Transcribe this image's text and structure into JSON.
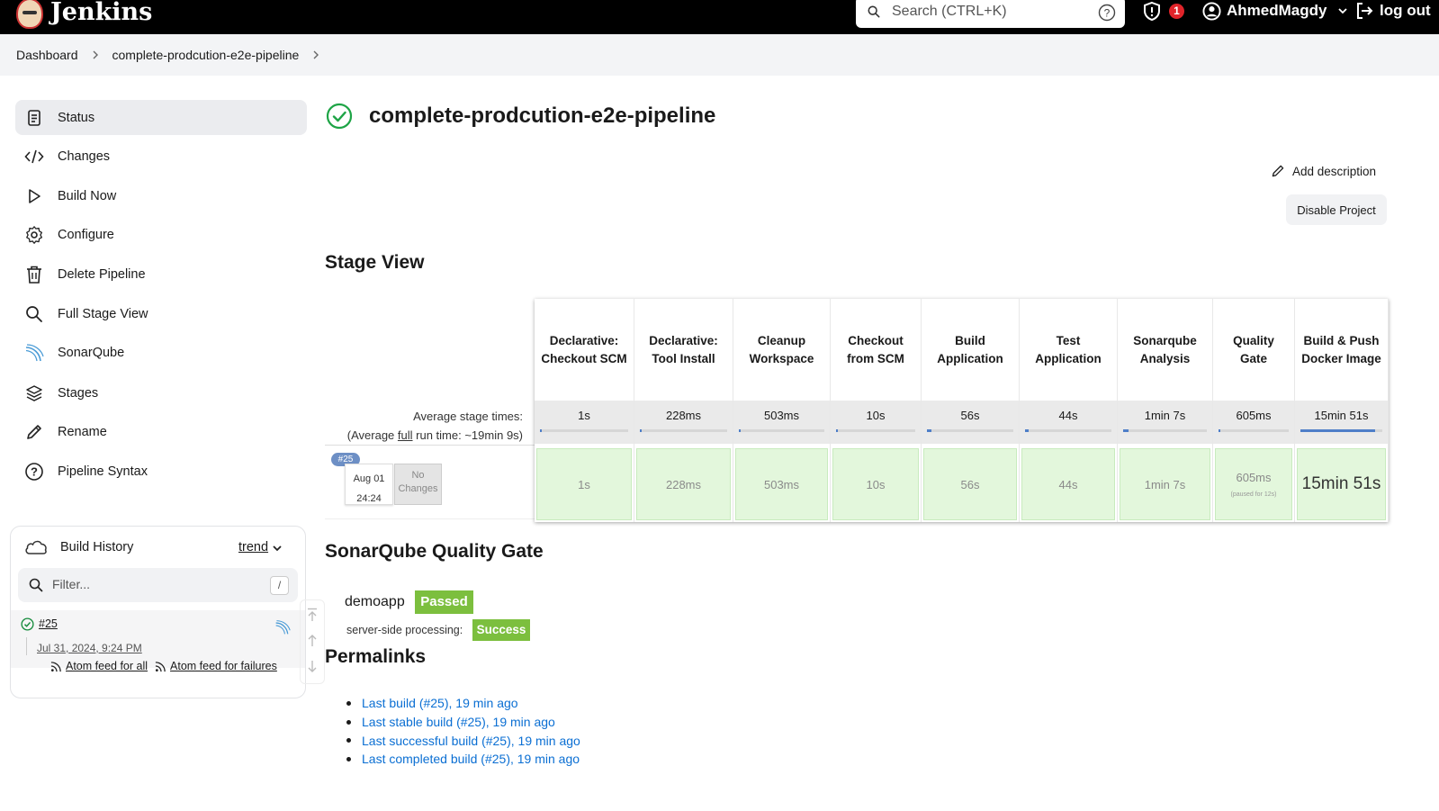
{
  "header": {
    "app_name": "Jenkins",
    "search_placeholder": "Search (CTRL+K)",
    "security_count": "1",
    "user_name": "AhmedMagdy",
    "logout_label": "log out"
  },
  "breadcrumb": {
    "items": [
      "Dashboard",
      "complete-prodcution-e2e-pipeline"
    ]
  },
  "sidebar": {
    "items": [
      {
        "label": "Status",
        "icon": "document-icon",
        "active": true
      },
      {
        "label": "Changes",
        "icon": "code-icon"
      },
      {
        "label": "Build Now",
        "icon": "play-icon"
      },
      {
        "label": "Configure",
        "icon": "gear-icon"
      },
      {
        "label": "Delete Pipeline",
        "icon": "trash-icon"
      },
      {
        "label": "Full Stage View",
        "icon": "magnifier-icon"
      },
      {
        "label": "SonarQube",
        "icon": "sonarqube-icon"
      },
      {
        "label": "Stages",
        "icon": "layers-icon"
      },
      {
        "label": "Rename",
        "icon": "pencil-icon"
      },
      {
        "label": "Pipeline Syntax",
        "icon": "question-circle-icon"
      }
    ]
  },
  "build_history": {
    "title": "Build History",
    "trend_label": "trend",
    "filter_placeholder": "Filter...",
    "filter_shortcut": "/",
    "builds": [
      {
        "number": "#25",
        "date": "Jul 31, 2024, 9:24 PM",
        "status": "success"
      }
    ],
    "feed_all": "Atom feed for all",
    "feed_failures": "Atom feed for failures"
  },
  "project": {
    "title": "complete-prodcution-e2e-pipeline",
    "add_description": "Add description",
    "disable_button": "Disable Project"
  },
  "stage_view": {
    "title": "Stage View",
    "avg_label_1": "Average stage times:",
    "avg_label_2_prefix": "(Average ",
    "avg_label_2_link": "full",
    "avg_label_2_suffix": " run time: ~19min 9s)",
    "build": {
      "badge": "#25",
      "date": "Aug 01",
      "time": "24:24",
      "changes": "No Changes"
    },
    "stages": [
      {
        "name": "Declarative: Checkout SCM",
        "avg": "1s",
        "run": "1s",
        "share": 0.001
      },
      {
        "name": "Declarative: Tool Install",
        "avg": "228ms",
        "run": "228ms",
        "share": 0.0002
      },
      {
        "name": "Cleanup Workspace",
        "avg": "503ms",
        "run": "503ms",
        "share": 0.0004
      },
      {
        "name": "Checkout from SCM",
        "avg": "10s",
        "run": "10s",
        "share": 0.009
      },
      {
        "name": "Build Application",
        "avg": "56s",
        "run": "56s",
        "share": 0.05
      },
      {
        "name": "Test Application",
        "avg": "44s",
        "run": "44s",
        "share": 0.04
      },
      {
        "name": "Sonarqube Analysis",
        "avg": "1min 7s",
        "run": "1min 7s",
        "share": 0.06
      },
      {
        "name": "Quality Gate",
        "avg": "605ms",
        "run": "605ms",
        "share": 0.0005,
        "note": "(paused for 12s)"
      },
      {
        "name": "Build & Push Docker Image",
        "avg": "15min 51s",
        "run": "15min 51s",
        "share": 0.83
      }
    ]
  },
  "sonarqube": {
    "title": "SonarQube Quality Gate",
    "project": "demoapp",
    "status": "Passed",
    "processing_label": "server-side processing:",
    "processing_status": "Success"
  },
  "permalinks": {
    "title": "Permalinks",
    "links": [
      "Last build (#25), 19 min ago",
      "Last stable build (#25), 19 min ago",
      "Last successful build (#25), 19 min ago",
      "Last completed build (#25), 19 min ago"
    ]
  },
  "colors": {
    "header_bg": "#000000",
    "success_green": "#7cbf3e",
    "link_blue": "#0b6fd3",
    "stage_cell_green": "#e3f7dc"
  }
}
